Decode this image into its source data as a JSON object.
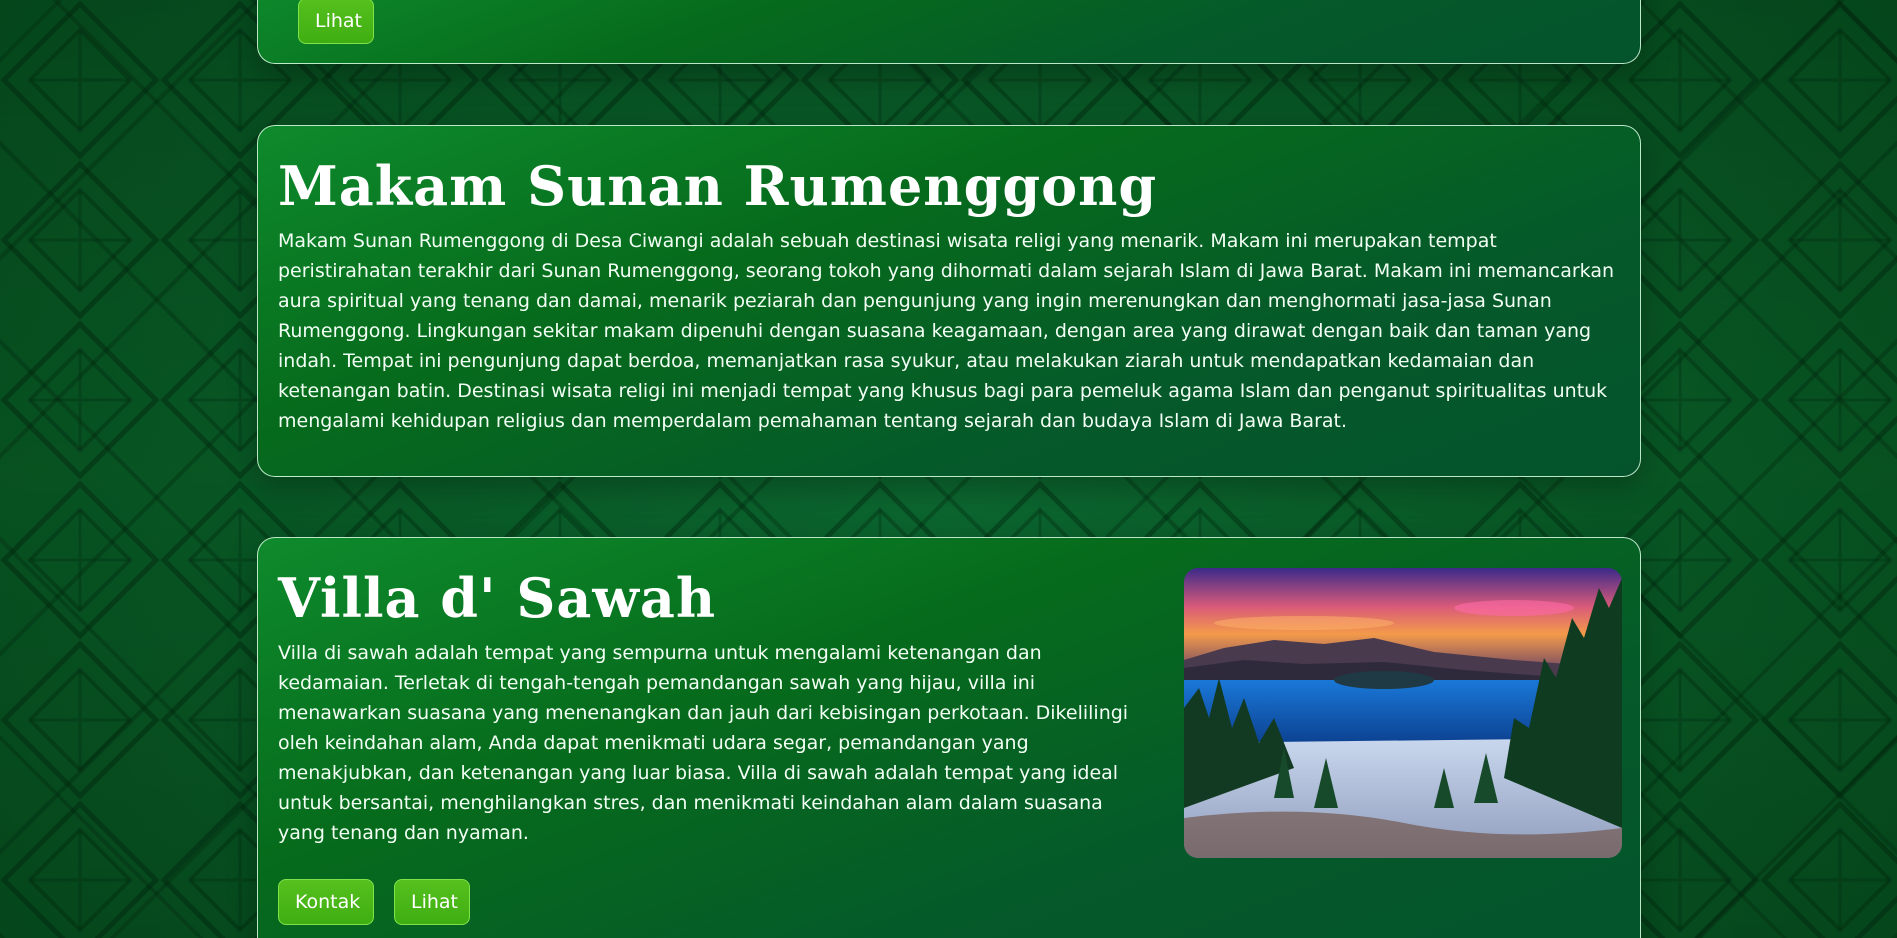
{
  "cards": {
    "top": {
      "view_label": "Lihat"
    },
    "makam": {
      "title": "Makam Sunan Rumenggong",
      "description": "Makam Sunan Rumenggong di Desa Ciwangi adalah sebuah destinasi wisata religi yang menarik. Makam ini merupakan tempat peristirahatan terakhir dari Sunan Rumenggong, seorang tokoh yang dihormati dalam sejarah Islam di Jawa Barat. Makam ini memancarkan aura spiritual yang tenang dan damai, menarik peziarah dan pengunjung yang ingin merenungkan dan menghormati jasa-jasa Sunan Rumenggong. Lingkungan sekitar makam dipenuhi dengan suasana keagamaan, dengan area yang dirawat dengan baik dan taman yang indah. Tempat ini pengunjung dapat berdoa, memanjatkan rasa syukur, atau melakukan ziarah untuk mendapatkan kedamaian dan ketenangan batin. Destinasi wisata religi ini menjadi tempat yang khusus bagi para pemeluk agama Islam dan penganut spiritualitas untuk mengalami kehidupan religius dan memperdalam pemahaman tentang sejarah dan budaya Islam di Jawa Barat."
    },
    "villa": {
      "title": "Villa d' Sawah",
      "description": "Villa di sawah adalah tempat yang sempurna untuk mengalami ketenangan dan kedamaian. Terletak di tengah-tengah pemandangan sawah yang hijau, villa ini menawarkan suasana yang menenangkan dan jauh dari kebisingan perkotaan. Dikelilingi oleh keindahan alam, Anda dapat menikmati udara segar, pemandangan yang menakjubkan, dan ketenangan yang luar biasa. Villa di sawah adalah tempat yang ideal untuk bersantai, menghilangkan stres, dan menikmati keindahan alam dalam suasana yang tenang dan nyaman.",
      "contact_label": "Kontak",
      "view_label": "Lihat"
    }
  },
  "colors": {
    "background": "#0a5a2a",
    "card_border": "#dcffe6",
    "button": "#4fba18",
    "text": "#ffffff"
  }
}
